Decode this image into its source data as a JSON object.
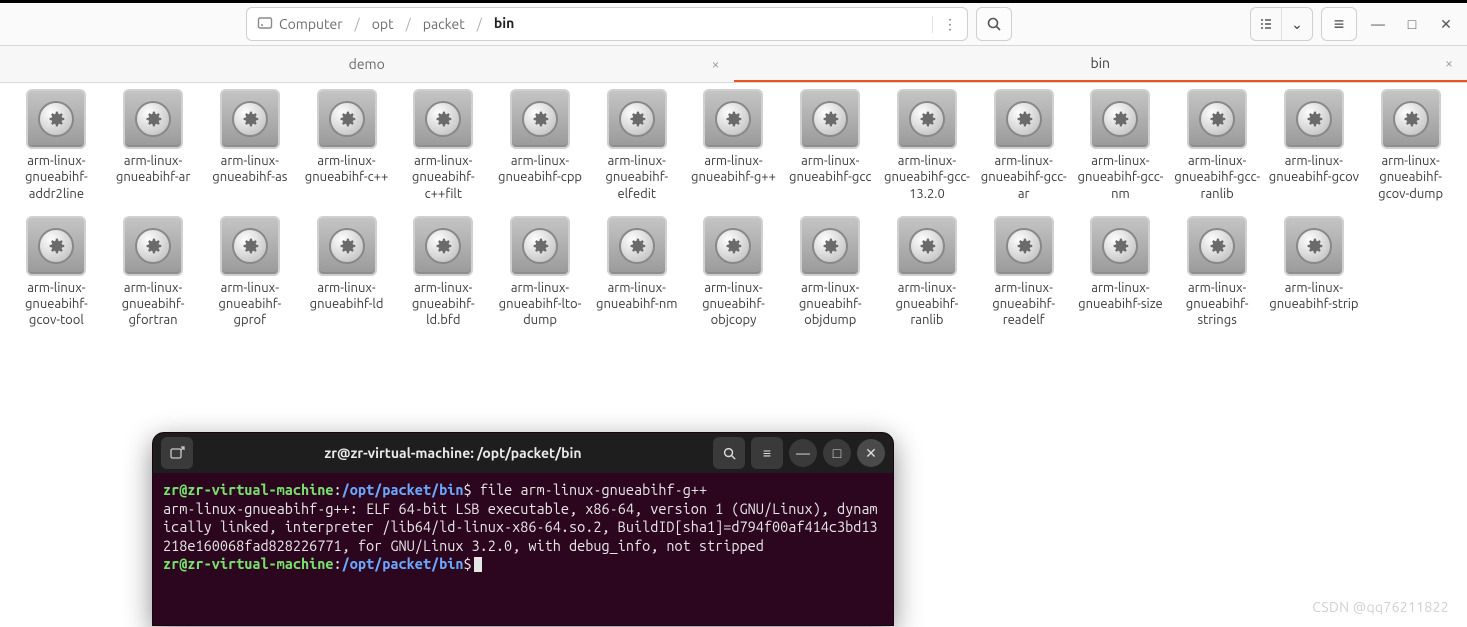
{
  "breadcrumb": {
    "root": "Computer",
    "parts": [
      "opt",
      "packet",
      "bin"
    ]
  },
  "tabs": [
    {
      "label": "demo",
      "active": false
    },
    {
      "label": "bin",
      "active": true
    }
  ],
  "files": [
    "arm-linux-gnueabihf-addr2line",
    "arm-linux-gnueabihf-ar",
    "arm-linux-gnueabihf-as",
    "arm-linux-gnueabihf-c++",
    "arm-linux-gnueabihf-c++filt",
    "arm-linux-gnueabihf-cpp",
    "arm-linux-gnueabihf-elfedit",
    "arm-linux-gnueabihf-g++",
    "arm-linux-gnueabihf-gcc",
    "arm-linux-gnueabihf-gcc-13.2.0",
    "arm-linux-gnueabihf-gcc-ar",
    "arm-linux-gnueabihf-gcc-nm",
    "arm-linux-gnueabihf-gcc-ranlib",
    "arm-linux-gnueabihf-gcov",
    "arm-linux-gnueabihf-gcov-dump",
    "arm-linux-gnueabihf-gcov-tool",
    "arm-linux-gnueabihf-gfortran",
    "arm-linux-gnueabihf-gprof",
    "arm-linux-gnueabihf-ld",
    "arm-linux-gnueabihf-ld.bfd",
    "arm-linux-gnueabihf-lto-dump",
    "arm-linux-gnueabihf-nm",
    "arm-linux-gnueabihf-objcopy",
    "arm-linux-gnueabihf-objdump",
    "arm-linux-gnueabihf-ranlib",
    "arm-linux-gnueabihf-readelf",
    "arm-linux-gnueabihf-size",
    "arm-linux-gnueabihf-strings",
    "arm-linux-gnueabihf-strip"
  ],
  "terminal": {
    "title": "zr@zr-virtual-machine: /opt/packet/bin",
    "prompt_user": "zr@zr-virtual-machine",
    "prompt_path": "/opt/packet/bin",
    "cmd1": "file arm-linux-gnueabihf-g++",
    "output": "arm-linux-gnueabihf-g++: ELF 64-bit LSB executable, x86-64, version 1 (GNU/Linux), dynamically linked, interpreter /lib64/ld-linux-x86-64.so.2, BuildID[sha1]=d794f00af414c3bd13218e160068fad828226771, for GNU/Linux 3.2.0, with debug_info, not stripped"
  },
  "watermark": "CSDN @qq76211822",
  "icons": {
    "hd": "hd-icon",
    "more": "⋮",
    "search": "search-icon",
    "list": "list-icon",
    "chev": "⌄",
    "hamburger": "≡",
    "min": "—",
    "max": "□",
    "close": "✕",
    "newtab": "new-tab-icon"
  }
}
